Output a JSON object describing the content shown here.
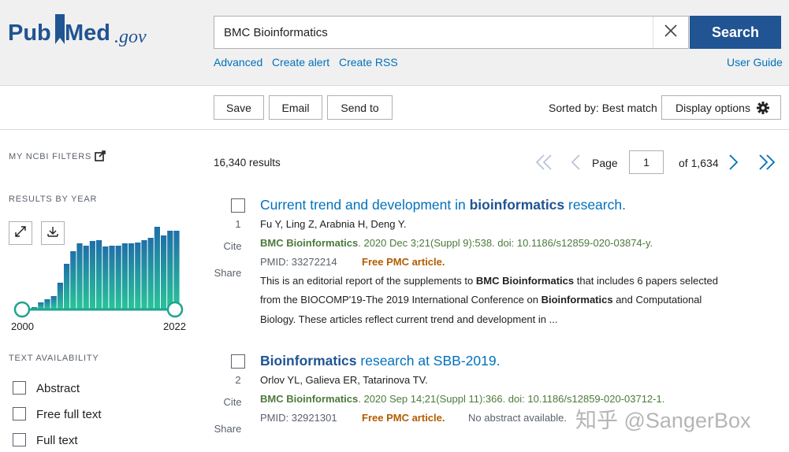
{
  "header": {
    "logo": {
      "pub": "Pub",
      "med": "Med",
      "gov": ".gov"
    },
    "search_value": "BMC Bioinformatics",
    "search_button": "Search",
    "links": [
      "Advanced",
      "Create alert",
      "Create RSS"
    ],
    "user_guide": "User Guide"
  },
  "toolbar": {
    "save": "Save",
    "email": "Email",
    "send_to": "Send to",
    "sorted_by": "Sorted by: Best match",
    "display_options": "Display options"
  },
  "sidebar": {
    "my_ncbi_filters": "MY NCBI FILTERS",
    "results_by_year": "RESULTS BY YEAR",
    "text_availability": "TEXT AVAILABILITY",
    "filters": [
      "Abstract",
      "Free full text",
      "Full text"
    ]
  },
  "chart_data": {
    "type": "bar",
    "title": "RESULTS BY YEAR",
    "categories": [
      "2000",
      "2001",
      "2002",
      "2003",
      "2004",
      "2005",
      "2006",
      "2007",
      "2008",
      "2009",
      "2010",
      "2011",
      "2012",
      "2013",
      "2014",
      "2015",
      "2016",
      "2017",
      "2018",
      "2019",
      "2020",
      "2021",
      "2022"
    ],
    "values": [
      2,
      8,
      12,
      16,
      33,
      57,
      73,
      83,
      80,
      86,
      87,
      79,
      80,
      80,
      83,
      83,
      84,
      87,
      90,
      104,
      93,
      99,
      99
    ],
    "xlabel": "",
    "ylabel": "",
    "range_labels": [
      "2000",
      "2022"
    ],
    "color": "#20a291"
  },
  "results_summary": {
    "count": "16,340 results",
    "page_label": "Page",
    "page": "1",
    "of": "of 1,634"
  },
  "results": [
    {
      "number": "1",
      "title_parts": [
        {
          "text": "Current trend and development in ",
          "bold": false
        },
        {
          "text": "bioinformatics",
          "bold": true
        },
        {
          "text": " research.",
          "bold": false
        }
      ],
      "authors": "Fu Y, Ling Z, Arabnia H, Deng Y.",
      "journal": "BMC Bioinformatics",
      "citation_rest": ". 2020 Dec 3;21(Suppl 9):538. doi: 10.1186/s12859-020-03874-y.",
      "pmid": "PMID: 33272214",
      "free_pmc": "Free PMC article.",
      "snippet_lines": [
        [
          {
            "text": "This is an editorial report of the supplements to ",
            "bold": false
          },
          {
            "text": "BMC Bioinformatics",
            "bold": true
          },
          {
            "text": " that includes 6 papers selected",
            "bold": false
          }
        ],
        [
          {
            "text": "from the BIOCOMP'19-The 2019 International Conference on ",
            "bold": false
          },
          {
            "text": "Bioinformatics",
            "bold": true
          },
          {
            "text": " and Computational",
            "bold": false
          }
        ],
        [
          {
            "text": "Biology. These articles reflect current trend and development in ...",
            "bold": false
          }
        ]
      ],
      "cite": "Cite",
      "share": "Share"
    },
    {
      "number": "2",
      "title_parts": [
        {
          "text": "Bioinformatics",
          "bold": true
        },
        {
          "text": " research at SBB-2019.",
          "bold": false
        }
      ],
      "authors": "Orlov YL, Galieva ER, Tatarinova TV.",
      "journal": "BMC Bioinformatics",
      "citation_rest": ". 2020 Sep 14;21(Suppl 11):366. doi: 10.1186/s12859-020-03712-1.",
      "pmid": "PMID: 32921301",
      "free_pmc": "Free PMC article.",
      "no_abstract": "No abstract available.",
      "cite": "Cite",
      "share": "Share"
    }
  ],
  "watermark": "知乎 @SangerBox"
}
